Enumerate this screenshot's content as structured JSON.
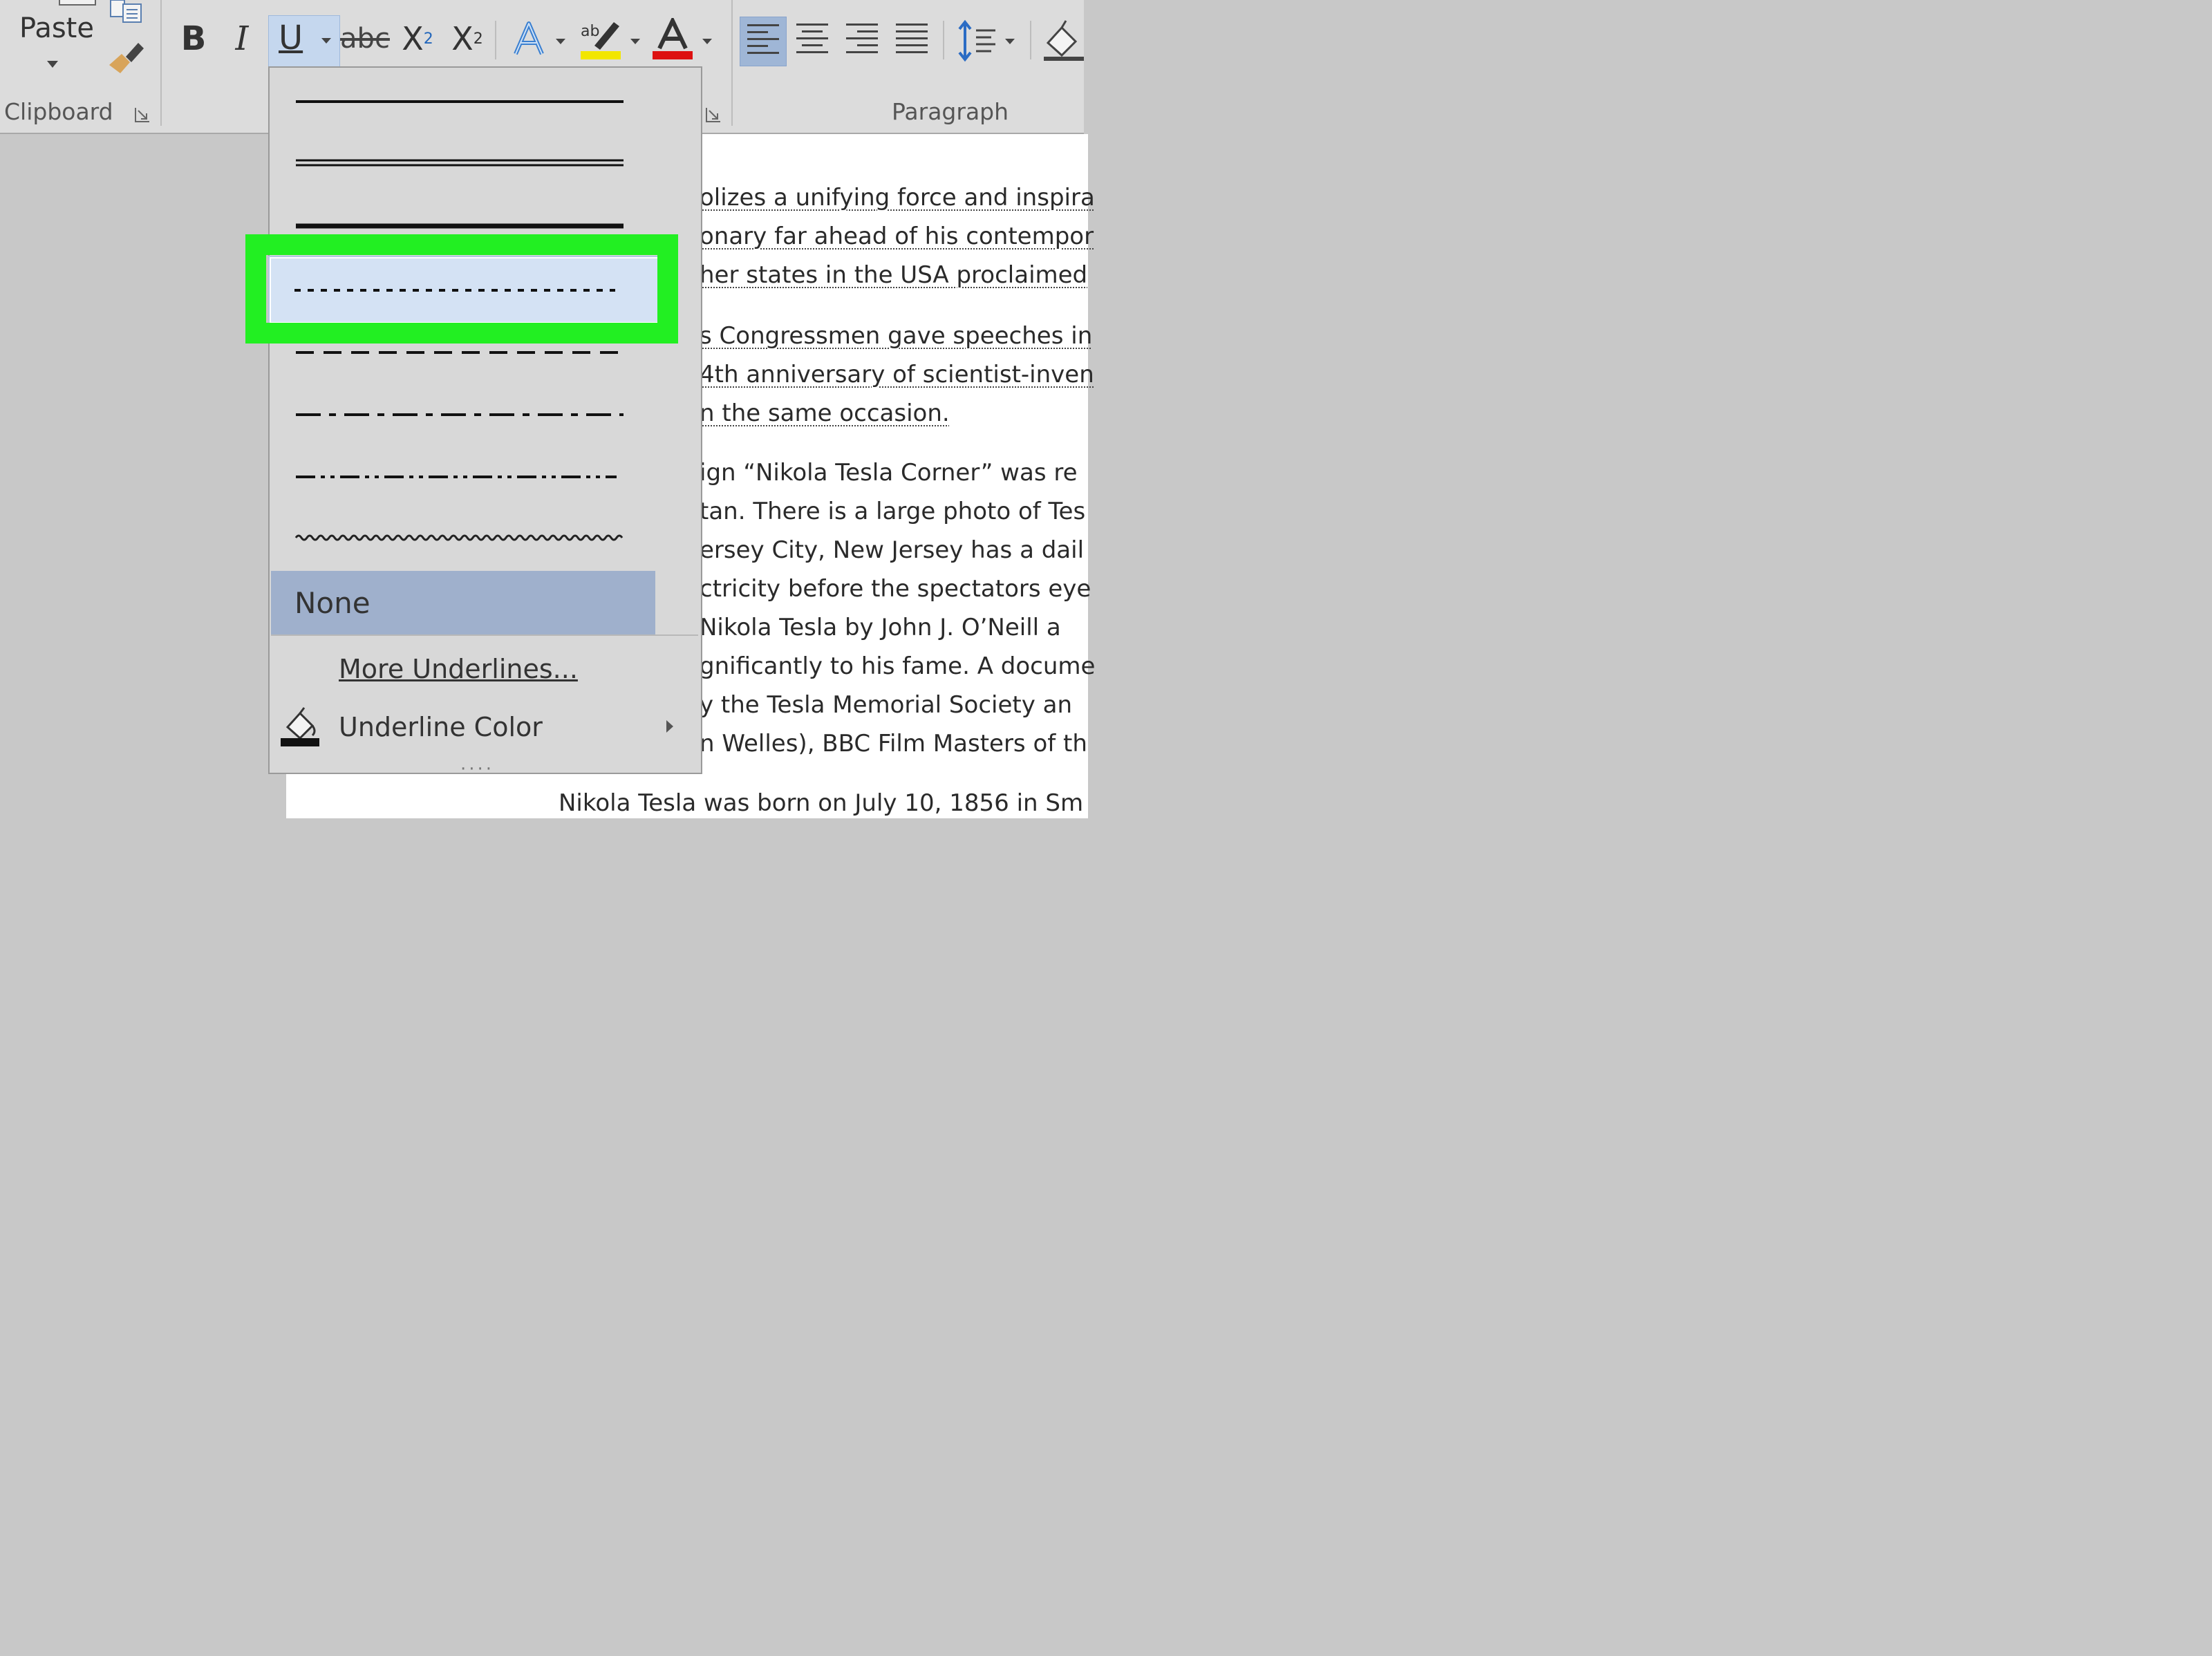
{
  "ribbon": {
    "clipboard": {
      "paste_label": "Paste",
      "group_label": "Clipboard"
    },
    "font": {
      "bold": "B",
      "italic": "I",
      "underline": "U",
      "strikethrough": "abc",
      "subscript_base": "X",
      "subscript_mark": "2",
      "superscript_base": "X",
      "superscript_mark": "2",
      "text_effects_icon": "text-effects-icon",
      "highlight_color": "#f2e600",
      "font_color": "#dd1111"
    },
    "paragraph": {
      "group_label": "Paragraph"
    }
  },
  "underline_menu": {
    "options": [
      {
        "name": "single",
        "selected": false
      },
      {
        "name": "double",
        "selected": false
      },
      {
        "name": "thick",
        "selected": false
      },
      {
        "name": "dotted",
        "selected": true
      },
      {
        "name": "dashed",
        "selected": false
      },
      {
        "name": "dot-dash",
        "selected": false
      },
      {
        "name": "dot-dot-dash",
        "selected": false
      },
      {
        "name": "wavy",
        "selected": false
      }
    ],
    "none_label": "None",
    "more_label": "More Underlines...",
    "color_label": "Underline Color",
    "highlight_color": "#22ef22"
  },
  "document": {
    "lines": [
      {
        "text": "olizes a unifying force and inspira",
        "underlined": true
      },
      {
        "text": "onary far ahead of his contempor",
        "underlined": true
      },
      {
        "text": "her states in the USA proclaimed",
        "underlined": true
      },
      {
        "text": "s Congressmen gave speeches in",
        "underlined": true
      },
      {
        "text": "4th anniversary of scientist-inven",
        "underlined": true
      },
      {
        "text": "n the same occasion.",
        "underlined": true
      },
      {
        "text": "ign “Nikola Tesla Corner” was re",
        "underlined": false
      },
      {
        "text": "tan. There is a large photo of Tes",
        "underlined": false
      },
      {
        "text": "ersey City, New Jersey has a dail",
        "underlined": false
      },
      {
        "text": "ctricity before the spectators eye",
        "underlined": false
      },
      {
        "text": " Nikola Tesla by John J. O’Neill  a",
        "underlined": false
      },
      {
        "text": "gnificantly to his fame. A docume",
        "underlined": false
      },
      {
        "text": "y the Tesla Memorial Society an",
        "underlined": false
      },
      {
        "text": "n Welles), BBC Film Masters of th",
        "underlined": false
      },
      {
        "text": "Nikola Tesla was born on July 10, 1856 in Sm",
        "underlined": false
      }
    ]
  }
}
